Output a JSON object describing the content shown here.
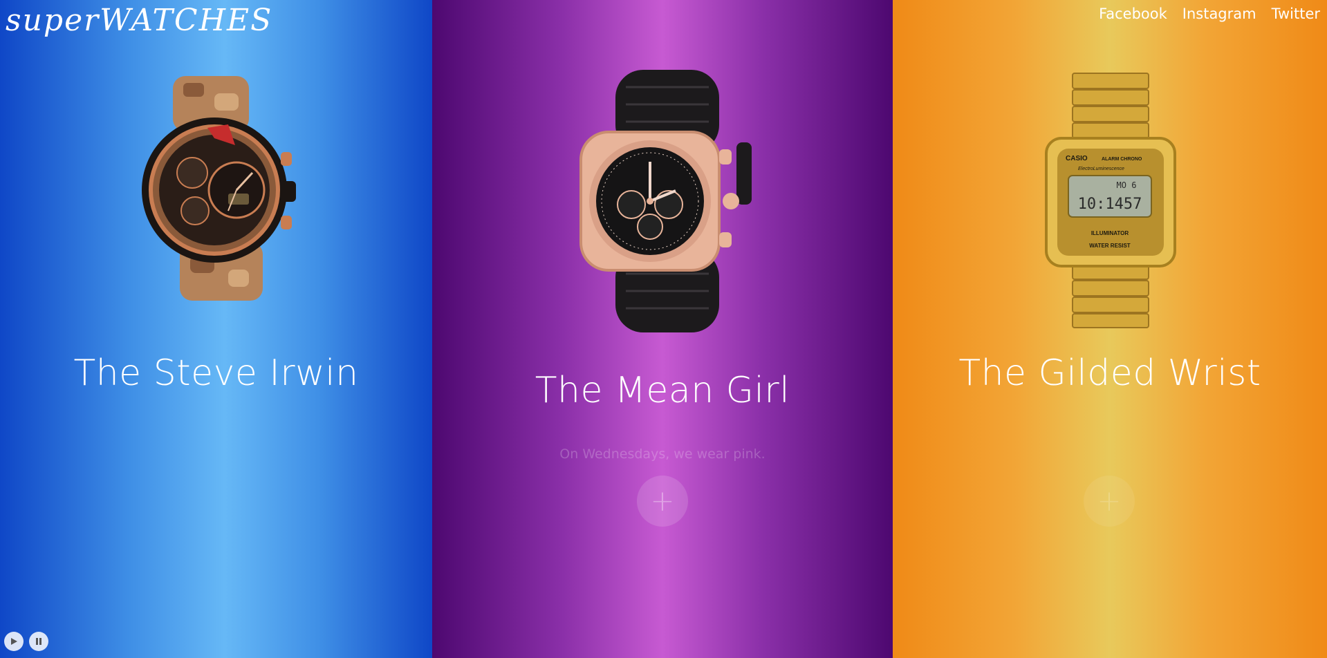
{
  "brand": {
    "logo_text": "superWATCHES"
  },
  "social": [
    {
      "label": "Facebook"
    },
    {
      "label": "Instagram"
    },
    {
      "label": "Twitter"
    }
  ],
  "panels": [
    {
      "title": "The Steve Irwin",
      "tagline": "",
      "plus": "+",
      "accent": "#66b8f6",
      "watch_icon": "camo-watch-icon"
    },
    {
      "title": "The Mean Girl",
      "tagline": "On Wednesdays, we wear pink.",
      "plus": "+",
      "accent": "#c75ad2",
      "watch_icon": "chronograph-watch-icon"
    },
    {
      "title": "The Gilded Wrist",
      "tagline": "",
      "plus": "+",
      "accent": "#e8c95b",
      "watch_icon": "casio-digital-watch-icon"
    }
  ],
  "casio": {
    "brand": "CASIO",
    "line1": "ALARM CHRONO",
    "line2": "ElectroLuminescence",
    "time": "10:1457",
    "day": "MO  6",
    "illum": "ILLUMINATOR",
    "water": "WATER RESIST"
  },
  "controls": {
    "play_icon": "play-icon",
    "pause_icon": "pause-icon"
  }
}
